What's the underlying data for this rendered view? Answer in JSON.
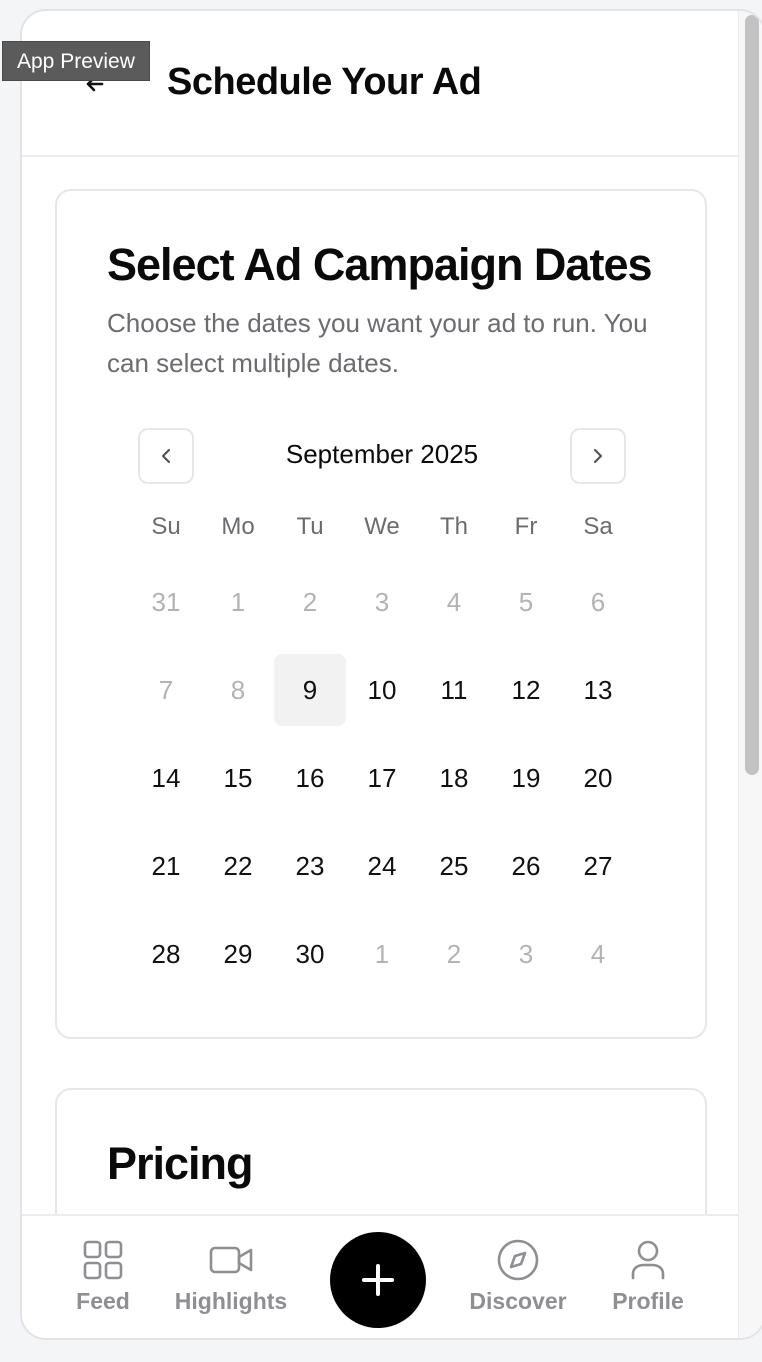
{
  "overlay": {
    "label": "App Preview"
  },
  "header": {
    "title": "Schedule Your Ad"
  },
  "dates_card": {
    "title": "Select Ad Campaign Dates",
    "description": "Choose the dates you want your ad to run. You can select multiple dates."
  },
  "calendar": {
    "month_label": "September 2025",
    "weekdays": [
      "Su",
      "Mo",
      "Tu",
      "We",
      "Th",
      "Fr",
      "Sa"
    ],
    "weeks": [
      [
        "31",
        "1",
        "2",
        "3",
        "4",
        "5",
        "6"
      ],
      [
        "7",
        "8",
        "9",
        "10",
        "11",
        "12",
        "13"
      ],
      [
        "14",
        "15",
        "16",
        "17",
        "18",
        "19",
        "20"
      ],
      [
        "21",
        "22",
        "23",
        "24",
        "25",
        "26",
        "27"
      ],
      [
        "28",
        "29",
        "30",
        "1",
        "2",
        "3",
        "4"
      ]
    ],
    "today": "9"
  },
  "pricing_card": {
    "title": "Pricing"
  },
  "bottom_nav": {
    "feed": "Feed",
    "highlights": "Highlights",
    "discover": "Discover",
    "profile": "Profile"
  },
  "colors": {
    "accent": "#000000",
    "muted_text": "#6b6b70",
    "disabled_day": "#b3b3b6",
    "nav_icon": "#8e8e93"
  }
}
